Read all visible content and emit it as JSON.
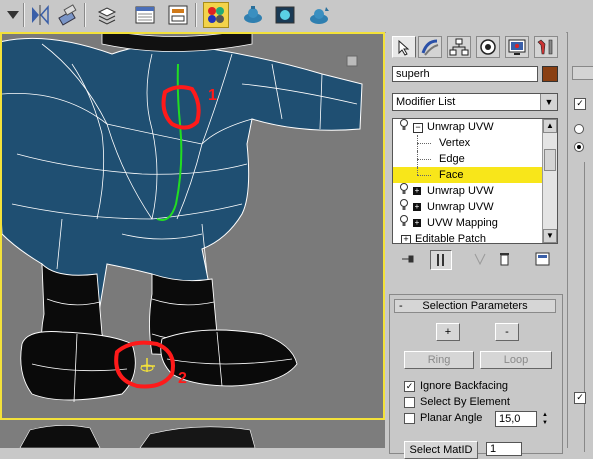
{
  "toolbar": {
    "buttons": [
      {
        "icon": "dropdown-icon"
      },
      {
        "icon": "mirror-icon"
      },
      {
        "icon": "align-icon"
      },
      {
        "icon": "layers-icon"
      },
      {
        "icon": "curve-editor-icon"
      },
      {
        "icon": "schematic-view-icon"
      },
      {
        "icon": "material-editor-icon",
        "active": true
      },
      {
        "icon": "render-scene-icon"
      },
      {
        "icon": "quick-render-icon"
      },
      {
        "icon": "render-last-icon"
      }
    ]
  },
  "viewport": {
    "annotations": [
      {
        "label": "1"
      },
      {
        "label": "2"
      }
    ],
    "annotation_color": "#ff1a1a",
    "seam_color": "#22dd22",
    "border_color": "#f3e13a"
  },
  "command_panel": {
    "tabs": [
      {
        "icon": "create-icon",
        "selected": true
      },
      {
        "icon": "modify-icon"
      },
      {
        "icon": "hierarchy-icon"
      },
      {
        "icon": "motion-icon"
      },
      {
        "icon": "display-icon"
      },
      {
        "icon": "utilities-icon"
      }
    ],
    "object_name": "superh",
    "object_color": "#8a3f12",
    "modifier_list_label": "Modifier List",
    "stack": [
      {
        "label": "Unwrap UVW",
        "type": "modifier",
        "expanded": true
      },
      {
        "label": "Vertex",
        "type": "sub"
      },
      {
        "label": "Edge",
        "type": "sub"
      },
      {
        "label": "Face",
        "type": "sub",
        "selected": true
      },
      {
        "label": "Unwrap UVW",
        "type": "modifier"
      },
      {
        "label": "Unwrap UVW",
        "type": "modifier"
      },
      {
        "label": "UVW Mapping",
        "type": "modifier"
      },
      {
        "label": "Editable Patch",
        "type": "base"
      }
    ],
    "stack_tools": [
      "pin-stack-icon",
      "show-end-result-icon",
      "make-unique-icon",
      "remove-modifier-icon",
      "configure-sets-icon"
    ],
    "selection_parameters": {
      "title": "Selection Parameters",
      "expand_symbol": "-",
      "grow_label": "+",
      "shrink_label": "-",
      "ring_label": "Ring",
      "loop_label": "Loop",
      "ignore_backfacing": {
        "label": "Ignore Backfacing",
        "checked": true
      },
      "select_by_element": {
        "label": "Select By Element",
        "checked": false
      },
      "planar_angle": {
        "label": "Planar Angle",
        "checked": false,
        "value": "15,0"
      },
      "select_matid_label": "Select MatID",
      "matid_value": "1"
    }
  }
}
